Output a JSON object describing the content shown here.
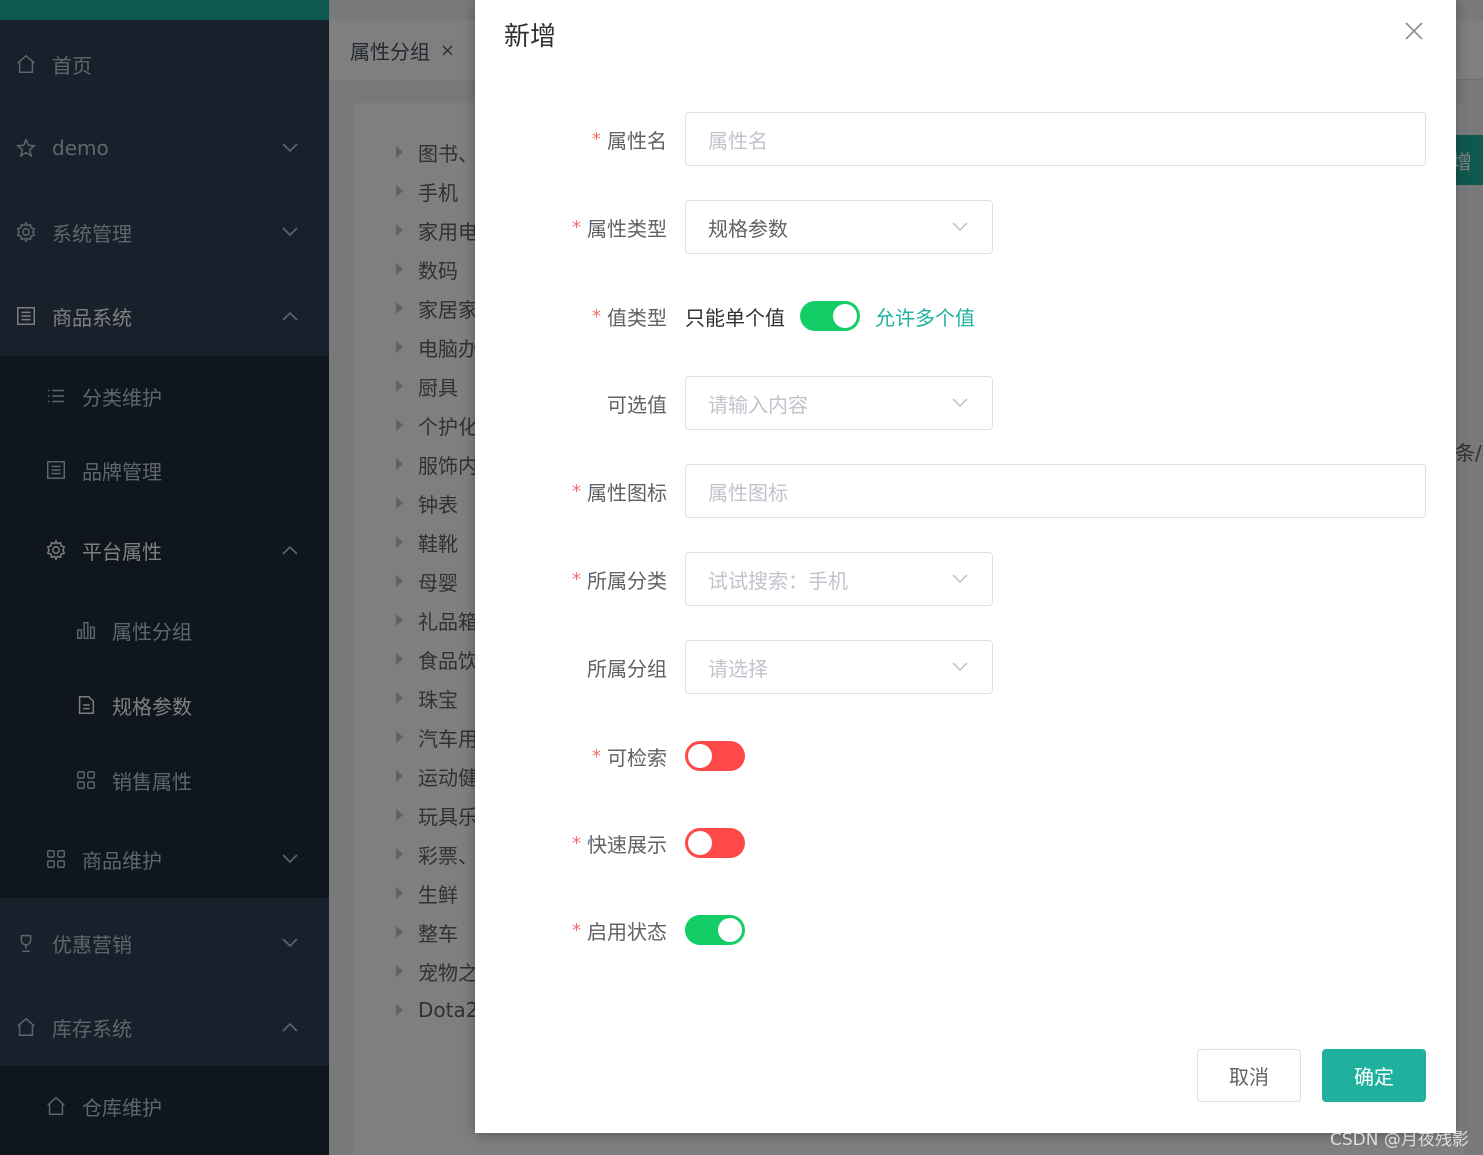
{
  "sidebar": {
    "items": [
      {
        "label": "首页",
        "icon": "home-icon"
      },
      {
        "label": "demo",
        "icon": "star-icon"
      },
      {
        "label": "系统管理",
        "icon": "gear-icon"
      },
      {
        "label": "商品系统",
        "icon": "document-list-icon"
      },
      {
        "label": "分类维护",
        "icon": "list-icon"
      },
      {
        "label": "品牌管理",
        "icon": "document-list-icon"
      },
      {
        "label": "平台属性",
        "icon": "gear-icon"
      },
      {
        "label": "属性分组",
        "icon": "bar-chart-icon"
      },
      {
        "label": "规格参数",
        "icon": "document-icon"
      },
      {
        "label": "销售属性",
        "icon": "grid-icon"
      },
      {
        "label": "商品维护",
        "icon": "grid-icon"
      },
      {
        "label": "优惠营销",
        "icon": "trophy-icon"
      },
      {
        "label": "库存系统",
        "icon": "home-icon"
      },
      {
        "label": "仓库维护",
        "icon": "home-icon"
      }
    ]
  },
  "tabs": {
    "active": "属性分组",
    "close": "×"
  },
  "tree": [
    "图书、",
    "手机",
    "家用电",
    "数码",
    "家居家",
    "电脑办",
    "厨具",
    "个护化",
    "服饰内",
    "钟表",
    "鞋靴",
    "母婴",
    "礼品箱",
    "食品饮",
    "珠宝",
    "汽车用",
    "运动健",
    "玩具乐",
    "彩票、",
    "生鲜",
    "整车",
    "宠物之",
    "Dota2"
  ],
  "background": {
    "add_btn": "增",
    "count_text": "条/"
  },
  "dialog": {
    "title": "新增",
    "fields": {
      "attr_name": {
        "label": "属性名",
        "placeholder": "属性名"
      },
      "attr_type": {
        "label": "属性类型",
        "value": "规格参数"
      },
      "value_type": {
        "label": "值类型",
        "left_text": "只能单个值",
        "right_text": "允许多个值",
        "on": true
      },
      "options": {
        "label": "可选值",
        "placeholder": "请输入内容"
      },
      "attr_icon": {
        "label": "属性图标",
        "placeholder": "属性图标"
      },
      "category": {
        "label": "所属分类",
        "placeholder": "试试搜索：手机"
      },
      "group": {
        "label": "所属分组",
        "placeholder": "请选择"
      },
      "searchable": {
        "label": "可检索",
        "on": false
      },
      "quick_show": {
        "label": "快速展示",
        "on": false
      },
      "enabled": {
        "label": "启用状态",
        "on": true
      }
    },
    "cancel": "取消",
    "confirm": "确定"
  },
  "watermark": "CSDN @月夜残影",
  "colors": {
    "accent": "#1fb19e",
    "switch_on": "#13ce66",
    "switch_off": "#ff4949",
    "required": "#f56c6c",
    "sidebar": "#304156"
  }
}
